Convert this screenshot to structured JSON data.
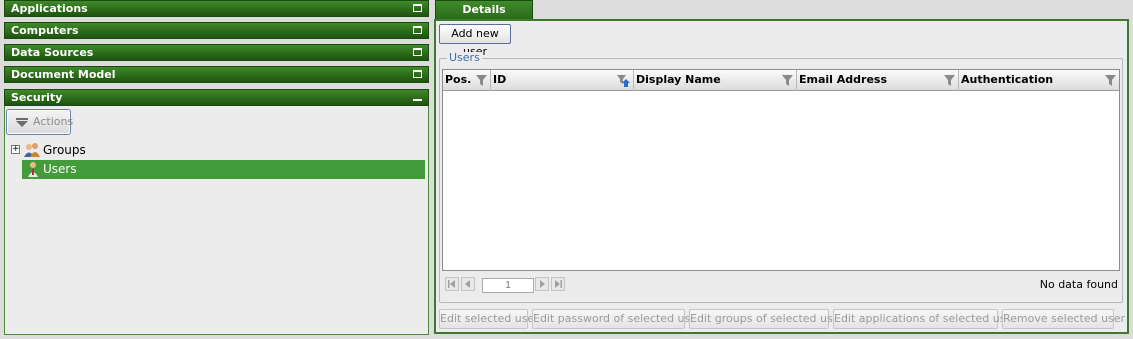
{
  "sidebar": {
    "sections": [
      {
        "label": "Applications"
      },
      {
        "label": "Computers"
      },
      {
        "label": "Data Sources"
      },
      {
        "label": "Document Model"
      },
      {
        "label": "Security"
      }
    ],
    "actions_label": "Actions",
    "tree": [
      {
        "label": "Groups",
        "expander": "+"
      },
      {
        "label": "Users"
      }
    ]
  },
  "tabs": [
    {
      "label": "Details"
    }
  ],
  "details": {
    "add_user_label": "Add new user",
    "group_title": "Users",
    "columns": [
      "Pos.",
      "ID",
      "Display Name",
      "Email Address",
      "Authentication"
    ],
    "rows": [],
    "pager": {
      "page": "1"
    },
    "empty_text": "No data found",
    "buttons": [
      "Edit selected user",
      "Edit password of selected user",
      "Edit groups of selected user",
      "Edit applications of selected user",
      "Remove selected user"
    ]
  },
  "colors": {
    "accent": "#2c6b1a",
    "selected": "#439b3a",
    "legend": "#3a6fb0"
  }
}
